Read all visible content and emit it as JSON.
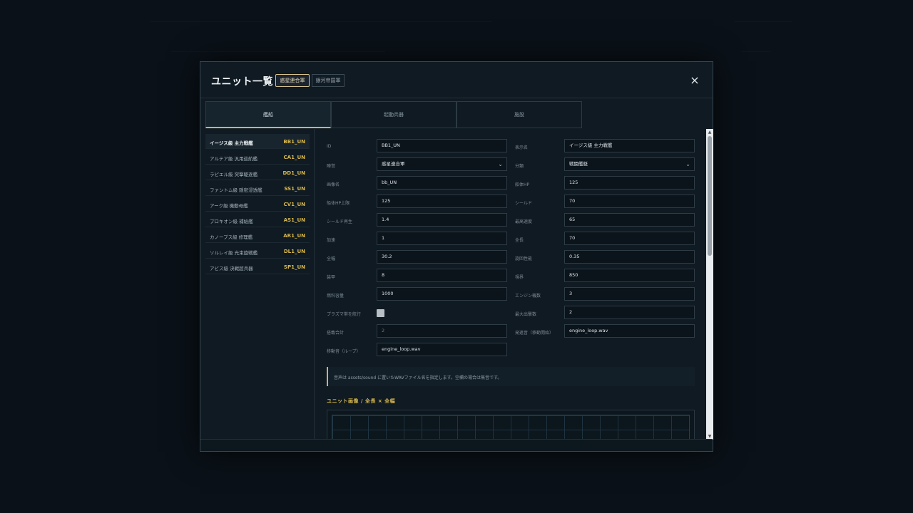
{
  "modal": {
    "title": "ユニット一覧",
    "factions": [
      {
        "label": "惑星連合軍",
        "active": true
      },
      {
        "label": "銀河帝国軍",
        "active": false
      }
    ],
    "close": "×"
  },
  "tabs": [
    {
      "label": "艦船",
      "active": true
    },
    {
      "label": "起動兵器",
      "active": false
    },
    {
      "label": "施設",
      "active": false
    }
  ],
  "units": [
    {
      "name": "イージス級 主力戦艦",
      "id": "BB1_UN"
    },
    {
      "name": "アルテア級 汎用巡航艦",
      "id": "CA1_UN"
    },
    {
      "name": "ラピエル級 突撃駆逐艦",
      "id": "DD1_UN"
    },
    {
      "name": "ファントム級 隠密浸透艦",
      "id": "SS1_UN"
    },
    {
      "name": "アーク級 機動母艦",
      "id": "CV1_UN"
    },
    {
      "name": "プロキオン級 補給艦",
      "id": "AS1_UN"
    },
    {
      "name": "カノープス級 修理艦",
      "id": "AR1_UN"
    },
    {
      "name": "ソルレイ級 光束旋戦艦",
      "id": "DL1_UN"
    },
    {
      "name": "アビス級 決戦超兵器",
      "id": "SP1_UN"
    }
  ],
  "form": {
    "id_label": "ID",
    "id_value": "BB1_UN",
    "display_name_label": "表示名",
    "display_name_value": "イージス級 主力戦艦",
    "faction_label": "陣営",
    "faction_value": "惑星連合軍",
    "category_label": "分類",
    "category_value": "戦闘艦艇",
    "image_name_label": "画像名",
    "image_name_value": "bb_UN",
    "hull_hp_label": "船体HP",
    "hull_hp_value": "125",
    "hull_hp_max_label": "船体HP上限",
    "hull_hp_max_value": "125",
    "shield_label": "シールド",
    "shield_value": "70",
    "shield_regen_label": "シールド再生",
    "shield_regen_value": "1.4",
    "max_speed_label": "最高速度",
    "max_speed_value": "65",
    "accel_label": "加速",
    "accel_value": "1",
    "length_label": "全長",
    "length_value": "70",
    "width_label": "全幅",
    "width_value": "30.2",
    "turn_speed_label": "旋回性能",
    "turn_speed_value": "0.35",
    "armor_label": "装甲",
    "armor_value": "8",
    "sight_label": "視界",
    "sight_value": "850",
    "fuel_label": "燃料容量",
    "fuel_value": "1000",
    "engine_count_label": "エンジン機数",
    "engine_count_value": "3",
    "plasma_label": "プラズマ帯を航行",
    "max_sortie_label": "最大出撃数",
    "max_sortie_value": "2",
    "total_mount_label": "搭載合計",
    "total_mount_value": "2",
    "start_sound_label": "発進音（移動開始）",
    "start_sound_value": "engine_loop.wav",
    "loop_sound_label": "移動音（ループ）",
    "loop_sound_value": "engine_loop.wav"
  },
  "note": "音声は assets/sound に置いたWAVファイル名を指定します。空欄の場合は無音です。",
  "image_section_title": "ユニット画像 / 全長 × 全幅",
  "icons": {
    "close": "close-icon",
    "dropdown": "chevron-down-icon"
  },
  "colors": {
    "accent": "#d9b84c",
    "background": "#0f1a22",
    "active_border": "#c9b27a"
  }
}
